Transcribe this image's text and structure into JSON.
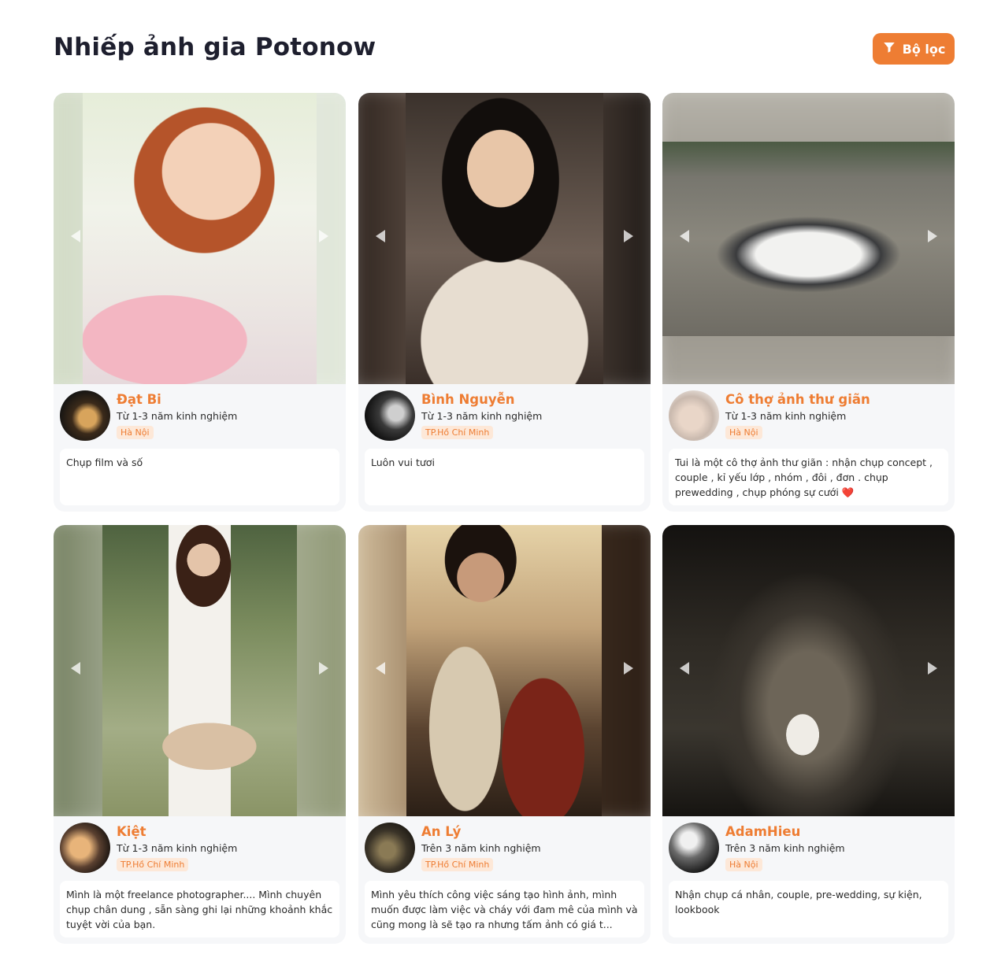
{
  "page": {
    "title": "Nhiếp ảnh gia Potonow",
    "filter_label": "Bộ lọc"
  },
  "icons": {
    "filter": "filter-icon",
    "prev": "caret-left-icon",
    "next": "caret-right-icon"
  },
  "colors": {
    "accent": "#ee7d33",
    "location_bg": "#fde8d8",
    "card_bg": "#f6f7f9"
  },
  "photographers": [
    {
      "name": "Đạt Bi",
      "experience": "Từ 1-3 năm kinh nghiệm",
      "location": "Hà Nội",
      "bio": "Chụp film và số"
    },
    {
      "name": "Bình Nguyễn",
      "experience": "Từ 1-3 năm kinh nghiệm",
      "location": "TP.Hồ Chí Minh",
      "bio": "Luôn vui tươi"
    },
    {
      "name": "Cô thợ ảnh thư giãn",
      "experience": "Từ 1-3 năm kinh nghiệm",
      "location": "Hà Nội",
      "bio": "Tui là một cô thợ ảnh thư giãn : nhận chụp concept , couple , kỉ yếu lớp , nhóm , đôi , đơn . chụp prewedding , chụp phóng sự cưới ❤️"
    },
    {
      "name": "Kiệt",
      "experience": "Từ 1-3 năm kinh nghiệm",
      "location": "TP.Hồ Chí Minh",
      "bio": "Mình là một freelance photographer.... Mình chuyên chụp chân dung , sẵn sàng ghi lại những khoảnh khắc tuyệt vời của bạn."
    },
    {
      "name": "An Lý",
      "experience": "Trên 3 năm kinh nghiệm",
      "location": "TP.Hồ Chí Minh",
      "bio": "Mình yêu thích công việc sáng tạo hình ảnh, mình muốn được làm việc và cháy với đam mê của mình và cũng mong là sẽ tạo ra nhưng tấm ảnh có giá t..."
    },
    {
      "name": "AdamHieu",
      "experience": "Trên 3 năm kinh nghiệm",
      "location": "Hà Nội",
      "bio": "Nhận chụp cá nhân, couple, pre-wedding, sự kiện, lookbook"
    }
  ]
}
